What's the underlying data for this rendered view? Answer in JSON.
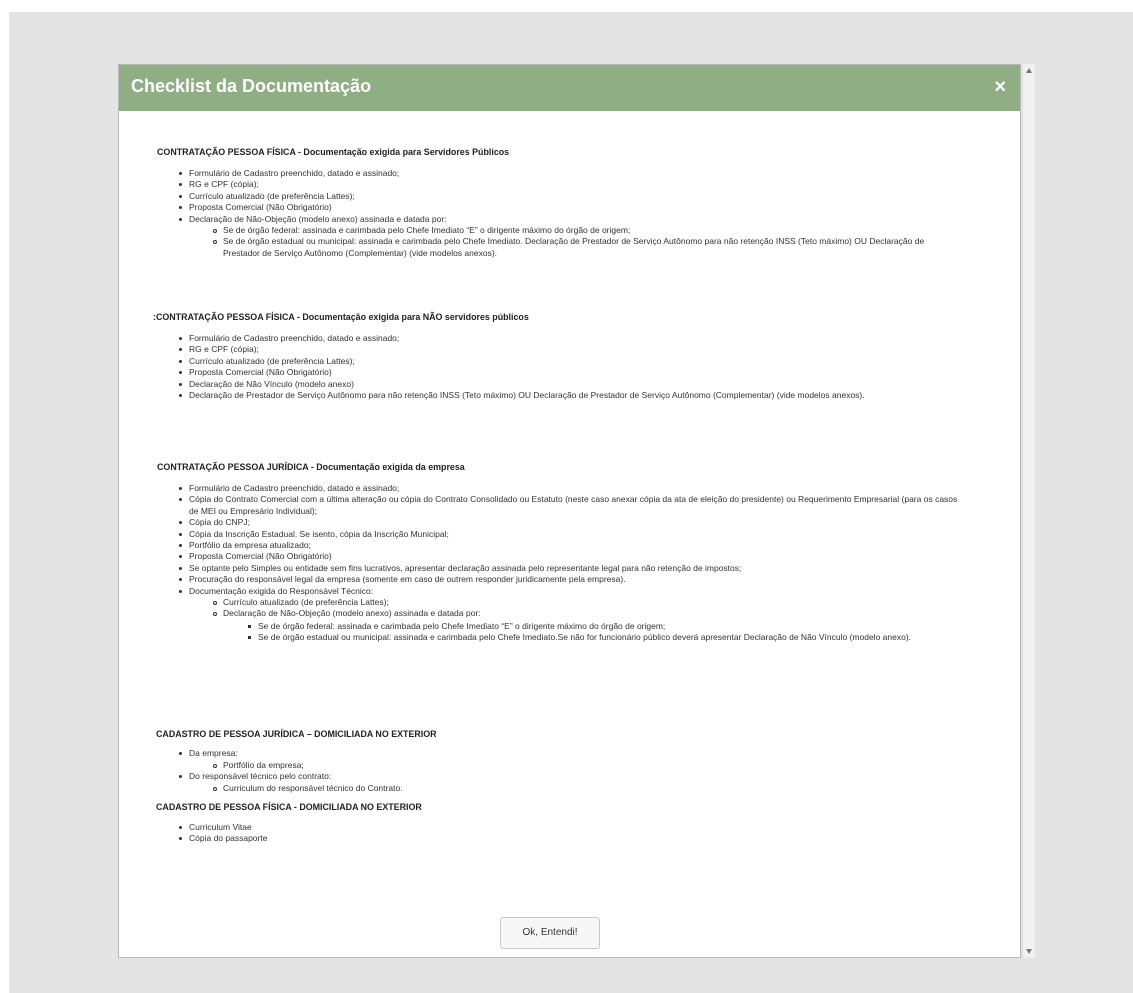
{
  "modal": {
    "title": "Checklist da Documentação",
    "close_label": "×",
    "ok_button": "Ok, Entendi!"
  },
  "sections": [
    {
      "title": "CONTRATAÇÃO PESSOA FÍSICA - Documentação exigida para Servidores Públicos",
      "items": [
        "Formulário de Cadastro preenchido, datado e assinado;",
        "RG e CPF (cópia);",
        "Currículo atualizado (de preferência Lattes);",
        "Proposta Comercial (Não Obrigatório)",
        "Declaração de Não-Objeção (modelo anexo) assinada e datada por:"
      ],
      "subitems": [
        "Se de órgão federal: assinada e carimbada pelo Chefe Imediato “E” o dirigente máximo do órgão de origem;",
        "Se de órgão estadual ou municipal: assinada e carimbada pelo Chefe Imediato. Declaração de Prestador de Serviço Autônomo para não retenção INSS (Teto máximo) OU Declaração de Prestador de Serviço Autônomo (Complementar) (vide modelos anexos)."
      ]
    },
    {
      "title": ":CONTRATAÇÃO PESSOA FÍSICA - Documentação exigida para NÃO servidores públicos",
      "items": [
        "Formulário de Cadastro preenchido, datado e assinado;",
        "RG e CPF (cópia);",
        "Currículo atualizado (de preferência Lattes);",
        "Proposta Comercial (Não Obrigatório)",
        "Declaração de Não Vínculo (modelo anexo)",
        "Declaração de Prestador de Serviço Autônomo para não retenção INSS (Teto máximo) OU Declaração de Prestador de Serviço Autônomo (Complementar) (vide modelos anexos)."
      ]
    },
    {
      "title": "CONTRATAÇÃO PESSOA JURÍDICA - Documentação exigida da empresa",
      "items": [
        "Formulário de Cadastro preenchido, datado e assinado;",
        "Cópia do Contrato Comercial com a última alteração ou cópia do Contrato Consolidado ou Estatuto (neste caso anexar cópia da ata de eleição do presidente) ou Requerimento Empresarial (para os casos de MEI ou Empresário Individual);",
        "Cópia do CNPJ;",
        "Cópia da Inscrição Estadual. Se isento, cópia da Inscrição Municipal;",
        "Portfólio da empresa atualizado;",
        "Proposta Comercial (Não Obrigatório)",
        "Se optante pelo Simples ou entidade sem fins lucrativos, apresentar declaração assinada pelo representante legal para não retenção de impostos;",
        "Procuração do responsável legal da empresa (somente em caso de outrem responder juridicamente pela empresa).",
        "Documentação exigida do Responsável Técnico:"
      ],
      "subitems": [
        "Currículo atualizado (de preferência Lattes);",
        "Declaração de Não-Objeção (modelo anexo) assinada e datada por:"
      ],
      "subsubitems": [
        "Se de órgão federal: assinada e carimbada pelo Chefe Imediato “E” o dirigente máximo do órgão de origem;",
        "Se de órgão estadual ou municipal: assinada e carimbada pelo Chefe Imediato.Se não for funcionário público deverá apresentar Declaração de Não Vínculo (modelo anexo)."
      ]
    },
    {
      "title": "CADASTRO DE PESSOA JURÍDICA – DOMICILIADA NO EXTERIOR",
      "items": [
        "Da empresa:",
        "Do responsável técnico pelo contrato:"
      ],
      "subitems": [
        "Portfólio da empresa;",
        "Curriculum do responsável técnico do Contrato."
      ]
    },
    {
      "title": "CADASTRO DE PESSOA FÍSICA - DOMICILIADA NO EXTERIOR",
      "items": [
        "Curriculum Vitae",
        "Cópia do passaporte"
      ]
    }
  ]
}
